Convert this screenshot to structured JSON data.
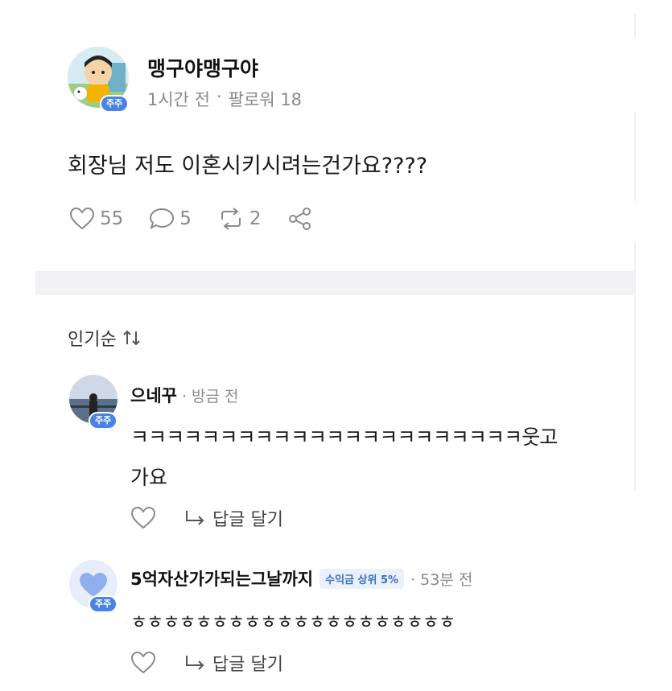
{
  "post": {
    "author": "맹구야맹구야",
    "badge": "주주",
    "time": "1시간 전",
    "separator": "·",
    "followers": "팔로워 18",
    "text": "회장님 저도 이혼시키시려는건가요????",
    "likes": "55",
    "comments": "5",
    "reposts": "2"
  },
  "sort": {
    "label": "인기순",
    "icon": "sort-arrows-icon"
  },
  "comments": [
    {
      "author": "으네꾸",
      "badge": "주주",
      "time": "· 방금 전",
      "line1": "ㅋㅋㅋㅋㅋㅋㅋㅋㅋㅋㅋㅋㅋㅋㅋㅋㅋㅋㅋㅋㅋㅋ웃고",
      "line2": "가요",
      "reply_label": "답글 달기"
    },
    {
      "author": "5억자산가가되는그날까지",
      "badge": "주주",
      "rank_badge": "수익금 상위 5%",
      "time": "· 53분 전",
      "text": "ㅎㅎㅎㅎㅎㅎㅎㅎㅎㅎㅎㅎㅎㅎㅎㅎㅎㅎㅎㅎ",
      "reply_label": "답글 달기"
    }
  ],
  "colors": {
    "badge": "#4a82e6",
    "muted": "#8a8a8a",
    "divider": "#f2f2f4"
  }
}
